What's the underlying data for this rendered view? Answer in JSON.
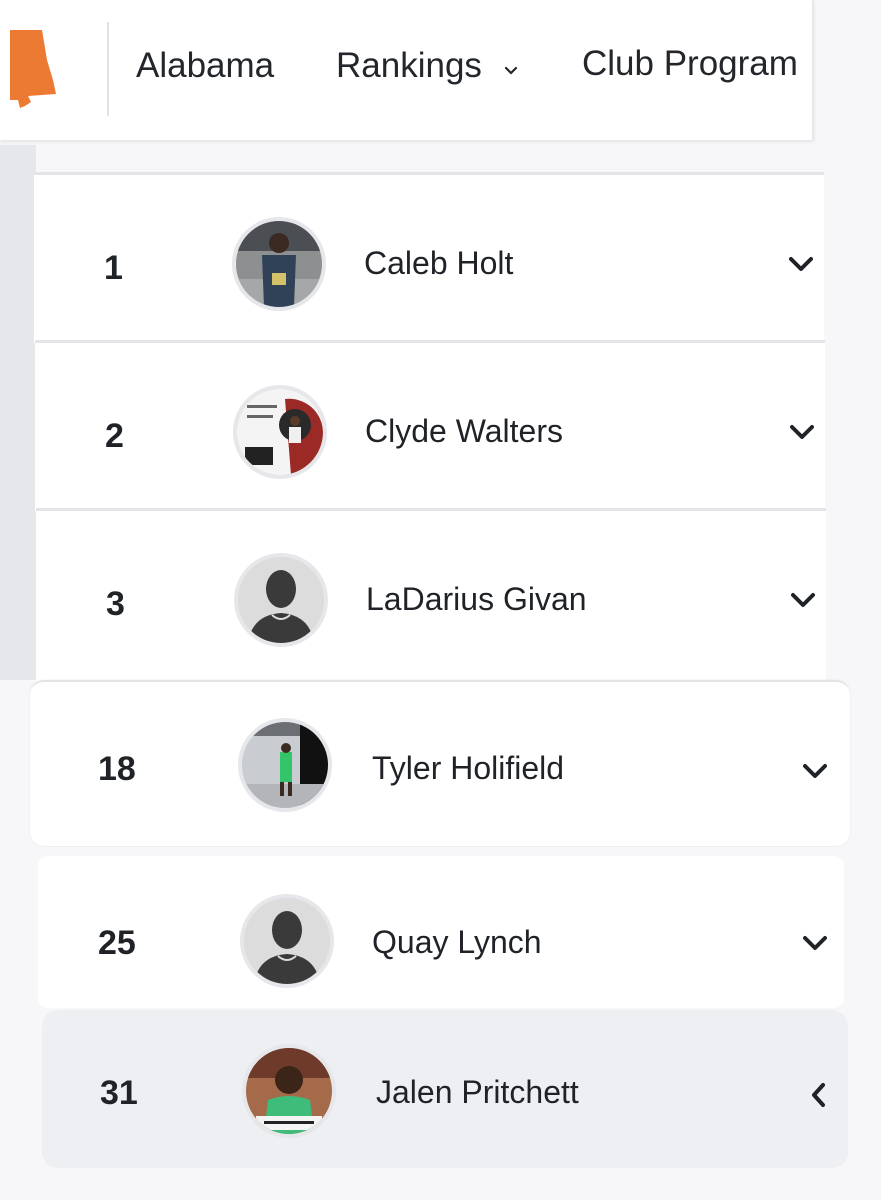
{
  "header": {
    "logo_icon": "alabama-state-icon",
    "brand_color": "#ec7a33",
    "nav": [
      {
        "label": "Alabama"
      },
      {
        "label": "Rankings",
        "icon": "chevron-down-icon"
      },
      {
        "label": "Club Program"
      }
    ]
  },
  "rankings": [
    {
      "rank": "1",
      "name": "Caleb Holt",
      "avatar": "player-photo",
      "toggle_icon": "chevron-down-icon"
    },
    {
      "rank": "2",
      "name": "Clyde Walters",
      "avatar": "promo-photo",
      "toggle_icon": "chevron-down-icon"
    },
    {
      "rank": "3",
      "name": "LaDarius Givan",
      "avatar": "placeholder-silhouette",
      "toggle_icon": "chevron-down-icon"
    },
    {
      "rank": "18",
      "name": "Tyler Holifield",
      "avatar": "player-photo",
      "toggle_icon": "chevron-down-icon"
    },
    {
      "rank": "25",
      "name": "Quay Lynch",
      "avatar": "placeholder-silhouette",
      "toggle_icon": "chevron-down-icon"
    },
    {
      "rank": "31",
      "name": "Jalen Pritchett",
      "avatar": "player-photo",
      "toggle_icon": "chevron-left-icon"
    }
  ]
}
